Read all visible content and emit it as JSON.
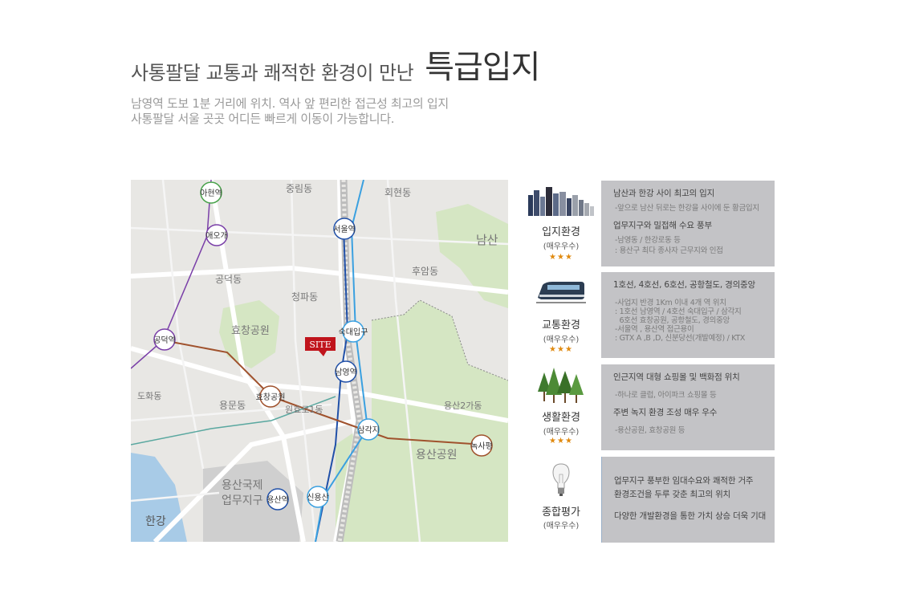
{
  "heading": {
    "main": "사통팔달 교통과 쾌적한 환경이 만난",
    "emphasis": "특급입지"
  },
  "subtitle": {
    "line1": "남영역 도보 1분 거리에 위치. 역사 앞 편리한 접근성 최고의 입지",
    "line2": "사통팔달 서울 곳곳 어디든 빠르게 이동이 가능합니다."
  },
  "map": {
    "site_label": "SITE",
    "stations": [
      "아현역",
      "애오개",
      "서울역",
      "공덕역",
      "숙대입구",
      "남영역",
      "효창공원",
      "삼각지",
      "녹사평",
      "용산역",
      "신용산"
    ],
    "areas": [
      "중림동",
      "회현동",
      "남산",
      "후암동",
      "청파동",
      "효창공원",
      "공덕동",
      "도화동",
      "용문동",
      "원효로1동",
      "용산2가동",
      "용산공원",
      "용산국제업무지구",
      "한강"
    ],
    "colors": {
      "park": "#d6e8c7",
      "water": "#a7cbe8",
      "road": "#ffffff",
      "line1": "#2050a8",
      "line4": "#3aa0e0",
      "line6": "#a0522d",
      "line5": "#7a3fa8"
    }
  },
  "cards": [
    {
      "title": "입지환경",
      "sub": "(매우우수)",
      "stars": "★★★",
      "icon": "buildings-icon",
      "lines": [
        {
          "type": "h",
          "text": "남산과 한강 사이 최고의 입지"
        },
        {
          "type": "d",
          "text": "-앞으로 남산 뒤로는 한강을 사이에 둔 황금입지"
        },
        {
          "type": "h",
          "text": "업무지구와 밀접해 수요 풍부"
        },
        {
          "type": "d",
          "text": "-남영동 / 한강로동 등"
        },
        {
          "type": "d2",
          "text": ": 용산구 최다 종사자 근무지와 인접"
        }
      ]
    },
    {
      "title": "교통환경",
      "sub": "(매우우수)",
      "stars": "★★★",
      "icon": "train-icon",
      "lines": [
        {
          "type": "h",
          "text": "1호선, 4호선, 6호선, 공항철도, 경의중앙"
        },
        {
          "type": "d",
          "text": "-사업지 반경 1Km 이내 4개 역 위치"
        },
        {
          "type": "d2",
          "text": ": 1호선 남영역 / 4호선 숙대입구 / 삼각지"
        },
        {
          "type": "d2",
          "text": "  6호선 효창공원, 공항철도, 경의중앙"
        },
        {
          "type": "d2",
          "text": "-서울역 , 용산역 접근용이"
        },
        {
          "type": "d2",
          "text": ": GTX A ,B ,D, 신분당선(개발예정) / KTX"
        }
      ]
    },
    {
      "title": "생활환경",
      "sub": "(매우우수)",
      "stars": "★★★",
      "icon": "trees-icon",
      "lines": [
        {
          "type": "h",
          "text": "인근지역 대형 쇼핑몰 및 백화점 위치"
        },
        {
          "type": "d",
          "text": "-하나로 클럽, 아이파크 쇼핑몰 등"
        },
        {
          "type": "h",
          "text": "주변 녹지 환경 조성 매우 우수"
        },
        {
          "type": "d",
          "text": "-용산공원, 효창공원 등"
        }
      ]
    },
    {
      "title": "종합평가",
      "sub": "(매우우수)",
      "stars": "",
      "icon": "lightbulb-icon",
      "lines": [
        {
          "type": "h",
          "text": "업무지구 풍부한 임대수요와 쾌적한 거주"
        },
        {
          "type": "h",
          "text": "환경조건을 두루 갖춘 최고의 위치"
        },
        {
          "type": "h",
          "text": "다양한 개발환경을 통한 가치 상승 더욱 기대"
        }
      ]
    }
  ]
}
